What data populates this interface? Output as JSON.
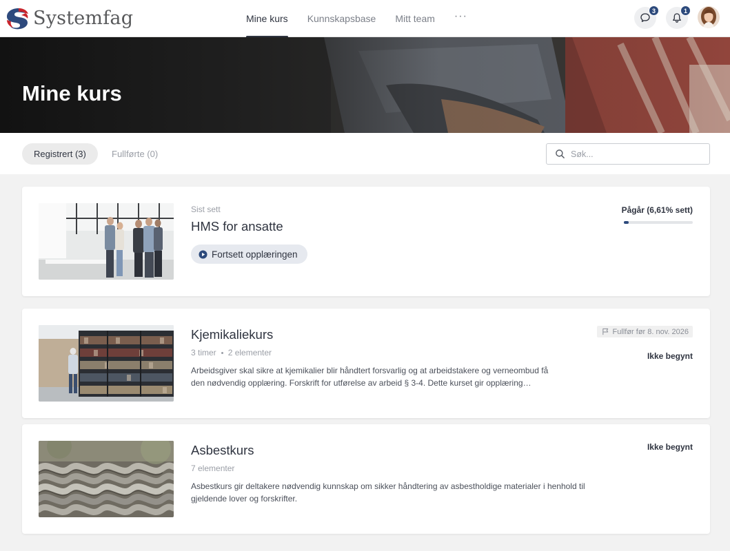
{
  "brand": {
    "name": "Systemfag"
  },
  "nav": {
    "items": [
      {
        "label": "Mine kurs",
        "active": true
      },
      {
        "label": "Kunnskapsbase",
        "active": false
      },
      {
        "label": "Mitt team",
        "active": false
      }
    ],
    "more_label": "···"
  },
  "header_actions": {
    "messages_count": "3",
    "notifications_count": "1"
  },
  "hero": {
    "title": "Mine kurs"
  },
  "filters": {
    "tabs": [
      {
        "label": "Registrert (3)",
        "active": true
      },
      {
        "label": "Fullførte (0)",
        "active": false
      }
    ],
    "search_placeholder": "Søk..."
  },
  "courses": [
    {
      "eyebrow": "Sist sett",
      "title": "HMS for ansatte",
      "action_label": "Fortsett opplæringen",
      "status": "Pågår (6,61% sett)",
      "progress_percent": 6.61
    },
    {
      "title": "Kjemikaliekurs",
      "duration": "3 timer",
      "elements": "2 elementer",
      "deadline": "Fullfør før 8. nov. 2026",
      "description": "Arbeidsgiver skal sikre at kjemikalier blir håndtert forsvarlig og at arbeidstakere og verneombud få den nødvendig opplæring. Forskrift for utførelse av arbeid § 3-4. Dette kurset gir opplæring…",
      "status": "Ikke begynt"
    },
    {
      "title": "Asbestkurs",
      "elements": "7 elementer",
      "description": "Asbestkurs gir deltakere nødvendig kunnskap om sikker håndtering av asbestholdige materialer i henhold til gjeldende lover og forskrifter.",
      "status": "Ikke begynt"
    }
  ],
  "colors": {
    "accent": "#2d4a7c",
    "logo_red": "#c9252c",
    "logo_blue": "#2e4a7d",
    "text": "#2f3440",
    "muted": "#9a9ea6"
  }
}
